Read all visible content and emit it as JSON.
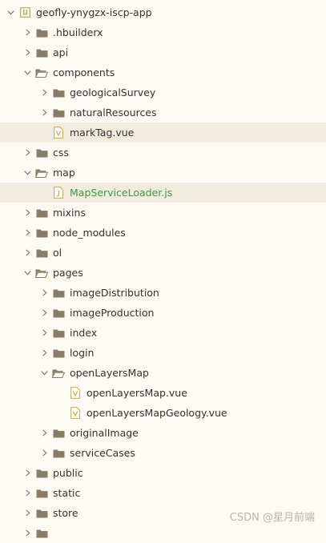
{
  "tree": [
    {
      "label": "geofly-ynygzx-iscp-app",
      "depth": 0,
      "type": "project",
      "expanded": true
    },
    {
      "label": ".hbuilderx",
      "depth": 1,
      "type": "folder",
      "expanded": false
    },
    {
      "label": "api",
      "depth": 1,
      "type": "folder",
      "expanded": false
    },
    {
      "label": "components",
      "depth": 1,
      "type": "folder",
      "expanded": true
    },
    {
      "label": "geologicalSurvey",
      "depth": 2,
      "type": "folder",
      "expanded": false
    },
    {
      "label": "naturalResources",
      "depth": 2,
      "type": "folder",
      "expanded": false
    },
    {
      "label": "markTag.vue",
      "depth": 2,
      "type": "vue",
      "highlight": true
    },
    {
      "label": "css",
      "depth": 1,
      "type": "folder",
      "expanded": false
    },
    {
      "label": "map",
      "depth": 1,
      "type": "folder",
      "expanded": true
    },
    {
      "label": "MapServiceLoader.js",
      "depth": 2,
      "type": "js",
      "highlight": true,
      "green": true
    },
    {
      "label": "mixins",
      "depth": 1,
      "type": "folder",
      "expanded": false
    },
    {
      "label": "node_modules",
      "depth": 1,
      "type": "folder",
      "expanded": false
    },
    {
      "label": "ol",
      "depth": 1,
      "type": "folder",
      "expanded": false
    },
    {
      "label": "pages",
      "depth": 1,
      "type": "folder",
      "expanded": true
    },
    {
      "label": "imageDistribution",
      "depth": 2,
      "type": "folder",
      "expanded": false
    },
    {
      "label": "imageProduction",
      "depth": 2,
      "type": "folder",
      "expanded": false
    },
    {
      "label": "index",
      "depth": 2,
      "type": "folder",
      "expanded": false
    },
    {
      "label": "login",
      "depth": 2,
      "type": "folder",
      "expanded": false
    },
    {
      "label": "openLayersMap",
      "depth": 2,
      "type": "folder",
      "expanded": true
    },
    {
      "label": "openLayersMap.vue",
      "depth": 3,
      "type": "vue"
    },
    {
      "label": "openLayersMapGeology.vue",
      "depth": 3,
      "type": "vue"
    },
    {
      "label": "originalImage",
      "depth": 2,
      "type": "folder",
      "expanded": false
    },
    {
      "label": "serviceCases",
      "depth": 2,
      "type": "folder",
      "expanded": false
    },
    {
      "label": "public",
      "depth": 1,
      "type": "folder",
      "expanded": false
    },
    {
      "label": "static",
      "depth": 1,
      "type": "folder",
      "expanded": false
    },
    {
      "label": "store",
      "depth": 1,
      "type": "folder",
      "expanded": false
    },
    {
      "label": "",
      "depth": 1,
      "type": "folder",
      "expanded": false
    }
  ],
  "watermark": "CSDN @星月前端",
  "colors": {
    "background": "#fcfaf2",
    "highlight": "#f1ecdd",
    "folder": "#8a7d66",
    "project_icon": "#c5a24f",
    "file_icon": "#c9a84c",
    "green_text": "#3a9a44",
    "chevron": "#777777"
  }
}
